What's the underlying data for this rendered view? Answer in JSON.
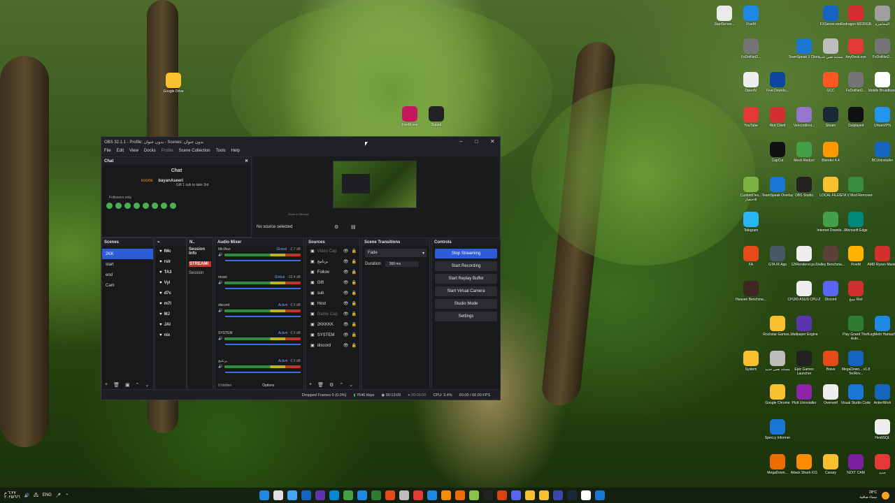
{
  "desktop": {
    "icons": [
      {
        "label": "StartServer...",
        "color": "#eaeaea"
      },
      {
        "label": "FiveM",
        "color": "#1e88e5"
      },
      {
        "label": "FXServer.exe",
        "color": "#1565c0"
      },
      {
        "label": "Redragon M32RGB",
        "color": "#d32f2f"
      },
      {
        "label": "المحاضرة",
        "color": "#9e9e9e"
      },
      {
        "label": "FxDotNet2...",
        "color": "#757575"
      },
      {
        "label": "TeamSpeak 3 Client",
        "color": "#1976d2"
      },
      {
        "label": "مستند نصي جديد",
        "color": "#bdbdbd"
      },
      {
        "label": "AnyDesk.exe",
        "color": "#e53935"
      },
      {
        "label": "FxDotNet2...",
        "color": "#757575"
      },
      {
        "label": "OpenIV",
        "color": "#eeeeee"
      },
      {
        "label": "Five Downlo...",
        "color": "#0d47a1"
      },
      {
        "label": "GCC",
        "color": "#ff5722"
      },
      {
        "label": "FxDotNet2...",
        "color": "#757575"
      },
      {
        "label": "Mobile Broadband",
        "color": "#ffffff"
      },
      {
        "label": "YouTube",
        "color": "#e53935"
      },
      {
        "label": "Riot Client",
        "color": "#d32f2f"
      },
      {
        "label": "Vencordinst...",
        "color": "#9575cd"
      },
      {
        "label": "Steam",
        "color": "#1b2838"
      },
      {
        "label": "Outplayed",
        "color": "#111111"
      },
      {
        "label": "UrbanVPN",
        "color": "#2196f3"
      },
      {
        "label": "CapCut",
        "color": "#111111"
      },
      {
        "label": "Mesh Reduct",
        "color": "#43a047"
      },
      {
        "label": "Blender 4.4",
        "color": "#ff9800"
      },
      {
        "label": "BCUninstaller",
        "color": "#1565c0"
      },
      {
        "label": "CustomDes... للاختصار",
        "color": "#7cb342"
      },
      {
        "label": "TeamSpeak Overlay",
        "color": "#1976d2"
      },
      {
        "label": "OBS Studio",
        "color": "#222222"
      },
      {
        "label": "LOCAL FILES",
        "color": "#fbc02d"
      },
      {
        "label": "GTA V Mod Remover",
        "color": "#388e3c"
      },
      {
        "label": "Telegram",
        "color": "#29b6f6"
      },
      {
        "label": "Internet Downlo...",
        "color": "#43a047"
      },
      {
        "label": "Microsoft Edge",
        "color": "#00897b"
      },
      {
        "label": "FA",
        "color": "#e64a19"
      },
      {
        "label": "GTA IR App",
        "color": "#455a64"
      },
      {
        "label": "12tRenderer.ps1",
        "color": "#eeeeee"
      },
      {
        "label": "Valley Benchma...",
        "color": "#5d4037"
      },
      {
        "label": "FiveM",
        "color": "#ffb300"
      },
      {
        "label": "AMD Ryzen Master",
        "color": "#d32f2f"
      },
      {
        "label": "Heaven Benchma...",
        "color": "#3e2723"
      },
      {
        "label": "CPUID ASUS CPU-Z",
        "color": "#eeeeee"
      },
      {
        "label": "Discord",
        "color": "#5865f2"
      },
      {
        "label": "نسخ Riot",
        "color": "#d32f2f"
      },
      {
        "label": "Rockstar Games...",
        "color": "#fbc02d"
      },
      {
        "label": "Wallpaper Engine",
        "color": "#5e35b1"
      },
      {
        "label": "Play Grand Theft Auto...",
        "color": "#2e7d32"
      },
      {
        "label": "LogMeIn Hamachi",
        "color": "#1e88e5"
      },
      {
        "label": "System",
        "color": "#fbc02d"
      },
      {
        "label": "مستند نصي جديد",
        "color": "#bdbdbd"
      },
      {
        "label": "Epic Games Launcher",
        "color": "#222222"
      },
      {
        "label": "Brave",
        "color": "#e64a19"
      },
      {
        "label": "MegaDown... v1.8 TecRev...",
        "color": "#1565c0"
      },
      {
        "label": "Google Chrome",
        "color": "#fbc02d"
      },
      {
        "label": "Plutt Uninstaller",
        "color": "#8e24aa"
      },
      {
        "label": "Overwolf",
        "color": "#eeeeee"
      },
      {
        "label": "Visual Studio Code",
        "color": "#1976d2"
      },
      {
        "label": "AnkerWork",
        "color": "#1565c0"
      },
      {
        "label": "Speccy Informer",
        "color": "#1976d2"
      },
      {
        "label": "HeidiSQL",
        "color": "#eeeeee"
      },
      {
        "label": "MegaDown...",
        "color": "#ef6c00"
      },
      {
        "label": "Attack Shark-X11",
        "color": "#fb8c00"
      },
      {
        "label": "Canary",
        "color": "#fbc02d"
      },
      {
        "label": "NZXT CAM",
        "color": "#7b1fa2"
      },
      {
        "label": "جديد",
        "color": "#e53935"
      },
      {
        "label": "Google Drive",
        "color": "#fbc02d"
      },
      {
        "label": "FiveM.exe",
        "color": "#c2185b"
      },
      {
        "label": "Squad",
        "color": "#222222"
      }
    ]
  },
  "obs": {
    "title": "OBS 32.1.1 - Profile: بدون عنوان - Scenes: بدون عنوان",
    "menu": [
      "File",
      "Edit",
      "View",
      "Docks",
      "Profile",
      "Scene Collection",
      "Tools",
      "Help"
    ],
    "chat": {
      "dock_title": "Chat",
      "header": "Chat",
      "user1": "koorte",
      "user2": "bayanAseeri",
      "line": "Gift 1 sub to take 3rd",
      "followers": "Followers only"
    },
    "preview": {
      "no_source": "No source selected",
      "scale": "Scale to Window"
    },
    "scenes": {
      "title": "Scenes",
      "items": [
        "2KK",
        "start",
        "end",
        "Cam"
      ]
    },
    "stream_items": [
      "IMc",
      "rslr",
      "TA3",
      "Vyi",
      "d7c",
      "m7l",
      "MJ",
      "JAI",
      "nix"
    ],
    "session": {
      "title": "Session Info",
      "streaming": "STREAMI",
      "label": "Session"
    },
    "mixer": {
      "title": "Audio Mixer",
      "tracks": [
        {
          "name": "Mic/Aux",
          "badge": "Global",
          "db": "-2.7 dB"
        },
        {
          "name": "music",
          "badge": "Global",
          "db": "-33.4 dB"
        },
        {
          "name": "discord",
          "badge": "Active",
          "db": "0.0 dB"
        },
        {
          "name": "SYSTEM",
          "badge": "Active",
          "db": "0.0 dB"
        },
        {
          "name": "برنامج",
          "badge": "Active",
          "db": "0.0 dB"
        }
      ],
      "hidden": "0 hidden",
      "options": "Options"
    },
    "sources": {
      "title": "Sources",
      "items": [
        "Video Cap",
        "برنامج",
        "Follow",
        "Gift",
        "sub",
        "Host",
        "Game Cap",
        "2KKKKK",
        "SYSTEM",
        "discord"
      ]
    },
    "transitions": {
      "title": "Scene Transitions",
      "type": "Fade",
      "duration_label": "Duration",
      "duration": "300 ms"
    },
    "controls": {
      "title": "Controls",
      "buttons": [
        "Stop Streaming",
        "Start Recording",
        "Start Replay Buffer",
        "Start Virtual Camera",
        "Studio Mode",
        "Settings"
      ]
    },
    "status": {
      "dropped": "Dropped Frames 0 (0.0%)",
      "kbps": "7640 kbps",
      "stream_time": "00:13:09",
      "rec_time": "00:00:00",
      "cpu": "CPU: 3.4%",
      "fps": "60.00 / 60.00 FPS"
    }
  },
  "taskbar": {
    "lang": "ENG",
    "time": "٦:٢٧ م",
    "date": "٢٠٢٥/٦/٦",
    "weather": "28°C",
    "weather_desc": "سماء صافية"
  }
}
